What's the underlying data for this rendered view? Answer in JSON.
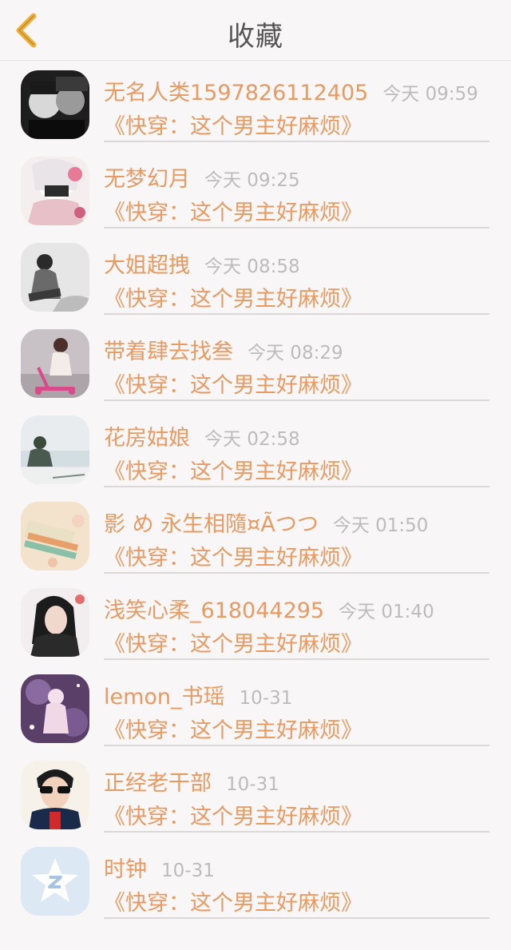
{
  "header": {
    "title": "收藏",
    "back_icon": "chevron-left-icon",
    "accent_color": "#f0b23a"
  },
  "favorites": [
    {
      "name": "无名人类1597826112405",
      "time": "今天 09:59",
      "book": "《快穿：这个男主好麻烦》",
      "avatar": "bw-couple-photo"
    },
    {
      "name": "无梦幻月",
      "time": "今天 09:25",
      "book": "《快穿：这个男主好麻烦》",
      "avatar": "anime-girl-illustration"
    },
    {
      "name": "大姐超拽",
      "time": "今天 08:58",
      "book": "《快穿：这个男主好麻烦》",
      "avatar": "bw-girl-photo"
    },
    {
      "name": "带着肆去找叁",
      "time": "今天 08:29",
      "book": "《快穿：这个男主好麻烦》",
      "avatar": "child-scooter-photo"
    },
    {
      "name": "花房姑娘",
      "time": "今天 02:58",
      "book": "《快穿：这个男主好麻烦》",
      "avatar": "girl-seaside-photo"
    },
    {
      "name": "影 め 永生相隨¤Ãつつ",
      "time": "今天 01:50",
      "book": "《快穿：这个男主好麻烦》",
      "avatar": "books-flowers-photo"
    },
    {
      "name": "浅笑心柔_618044295",
      "time": "今天 01:40",
      "book": "《快穿：这个男主好麻烦》",
      "avatar": "girl-dark-hair-photo"
    },
    {
      "name": "lemon_书瑶",
      "time": "10-31",
      "book": "《快穿：这个男主好麻烦》",
      "avatar": "anime-purple-illustration"
    },
    {
      "name": "正经老干部",
      "time": "10-31",
      "book": "《快穿：这个男主好麻烦》",
      "avatar": "boy-sunglasses-photo"
    },
    {
      "name": "时钟",
      "time": "10-31",
      "book": "《快穿：这个男主好麻烦》",
      "avatar": "qq-star-icon"
    }
  ],
  "colors": {
    "name": "#e89a63",
    "time": "#bcbcbc",
    "background": "#f8f6f6"
  }
}
